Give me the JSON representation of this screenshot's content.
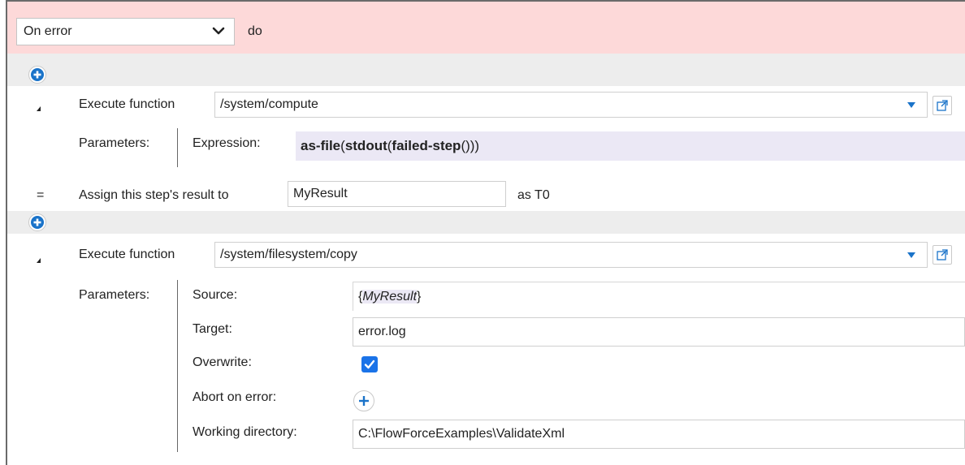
{
  "header": {
    "condition_select": "On error",
    "do_label": "do"
  },
  "step1": {
    "execute_label": "Execute function",
    "function_path": "/system/compute",
    "parameters_label": "Parameters:",
    "expression_label": "Expression:",
    "expression": {
      "fn1": "as-file",
      "p1": "(",
      "fn2": "stdout",
      "p2": "(",
      "fn3": "failed-step",
      "p3": "()))"
    },
    "assign_symbol": "=",
    "assign_label": "Assign this step's result to",
    "assign_value": "MyResult",
    "as_type": "as T0"
  },
  "step2": {
    "execute_label": "Execute function",
    "function_path": "/system/filesystem/copy",
    "parameters_label": "Parameters:",
    "params": {
      "source_label": "Source:",
      "source_open": "{",
      "source_var": "MyResult",
      "source_close": "}",
      "target_label": "Target:",
      "target_value": "error.log",
      "overwrite_label": "Overwrite:",
      "overwrite_checked": true,
      "abort_label": "Abort on error:",
      "working_dir_label": "Working directory:",
      "working_dir_value": "C:\\FlowForceExamples\\ValidateXml"
    }
  },
  "colors": {
    "header_bg": "#fdd9d9",
    "band_bg": "#ededed",
    "accent_blue": "#1a73c9",
    "expression_bg": "#ebe8f5"
  },
  "icons": {
    "dropdown": "chevron-down-icon",
    "add": "plus-icon",
    "open_external": "external-link-icon",
    "collapse": "collapse-triangle-icon",
    "check": "checkmark-icon"
  }
}
